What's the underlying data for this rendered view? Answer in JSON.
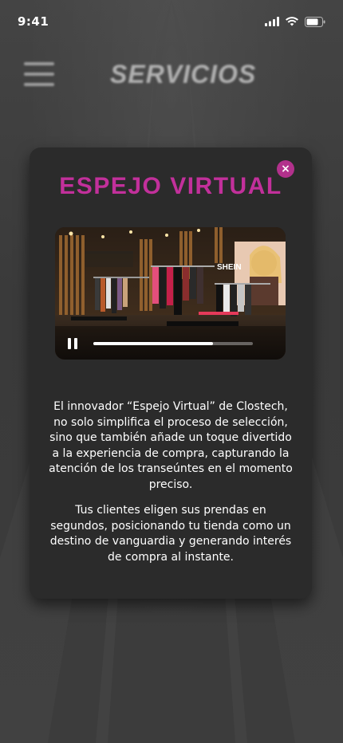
{
  "status_bar": {
    "time": "9:41"
  },
  "header": {
    "title": "SERVICIOS"
  },
  "modal": {
    "title": "ESPEJO VIRTUAL",
    "close_symbol": "×",
    "video": {
      "progress": 0.75,
      "sign_text": "SHEIN"
    },
    "paragraph_1": "El innovador “Espejo Virtual” de Clostech, no solo simplifica el proceso de selección, sino que también añade un toque divertido a la experiencia de compra, capturando la atención de los transeúntes en el momento preciso.",
    "paragraph_2": "Tus clientes eligen sus prendas en segundos, posicionando tu tienda como un destino de vanguardia y generando interés de compra al instante."
  },
  "colors": {
    "accent": "#c2309b",
    "close_button": "#b2318c",
    "card": "#2b2b2b",
    "background": "#3b3b3b"
  },
  "icons": [
    "signal-icon",
    "wifi-icon",
    "battery-icon",
    "hamburger-menu-icon",
    "close-icon",
    "pause-icon"
  ]
}
